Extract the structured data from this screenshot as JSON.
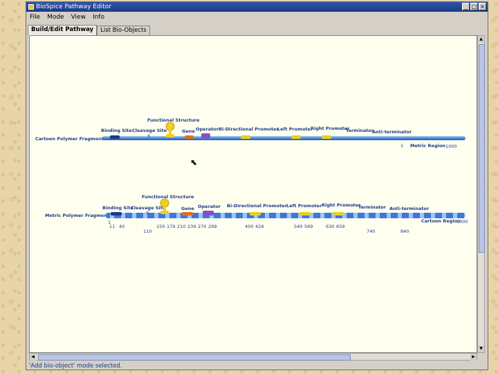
{
  "window": {
    "title": "BioSpice Pathway Editor",
    "buttons": [
      "_",
      "□",
      "×"
    ]
  },
  "menu": [
    "File",
    "Mode",
    "View",
    "Info"
  ],
  "tabs": [
    "Build/Edit Pathway",
    "List Bio-Objects"
  ],
  "fragment1": {
    "name": "Cartoon Polymer Fragment",
    "labels": {
      "functional": "Functional Structure",
      "binding": "Binding Site",
      "cleavage": "Cleavage Site",
      "gene": "Gene",
      "operator": "Operator",
      "bidir": "Bi-Directional Promoter",
      "left": "Left Promoter",
      "right": "Right Promoter",
      "terminator": "Terminator",
      "anti": "Anti-terminator"
    },
    "start": "1",
    "region_label": "Metric Region",
    "end": "1000"
  },
  "fragment2": {
    "name": "Metric Polymer Fragment",
    "labels": {
      "functional": "Functional Structure",
      "binding": "Binding Site",
      "cleavage": "Cleavage Site",
      "gene": "Gene",
      "operator": "Operator",
      "bidir": "Bi-Directional Promoter",
      "left": "Left Promoter",
      "right": "Right Promoter",
      "terminator": "Terminator",
      "anti": "Anti-terminator"
    },
    "start": "1",
    "region_label": "Cartoon Region",
    "end": "1000",
    "positions_top": [
      "11",
      "40",
      "150",
      "179",
      "210",
      "239",
      "270",
      "299",
      "400",
      "429",
      "540",
      "569",
      "630",
      "659"
    ],
    "positions_bottom": [
      "110",
      "740",
      "840"
    ]
  },
  "status": "'Add bio-object' mode selected.",
  "colors": {
    "titlebar": "#1c3a86",
    "label": "#1c3a86",
    "canvas": "#fffff0",
    "gene": "#e07020",
    "operator": "#8a4fc8",
    "promoter": "#e8d020",
    "binding": "#1c3a86"
  }
}
